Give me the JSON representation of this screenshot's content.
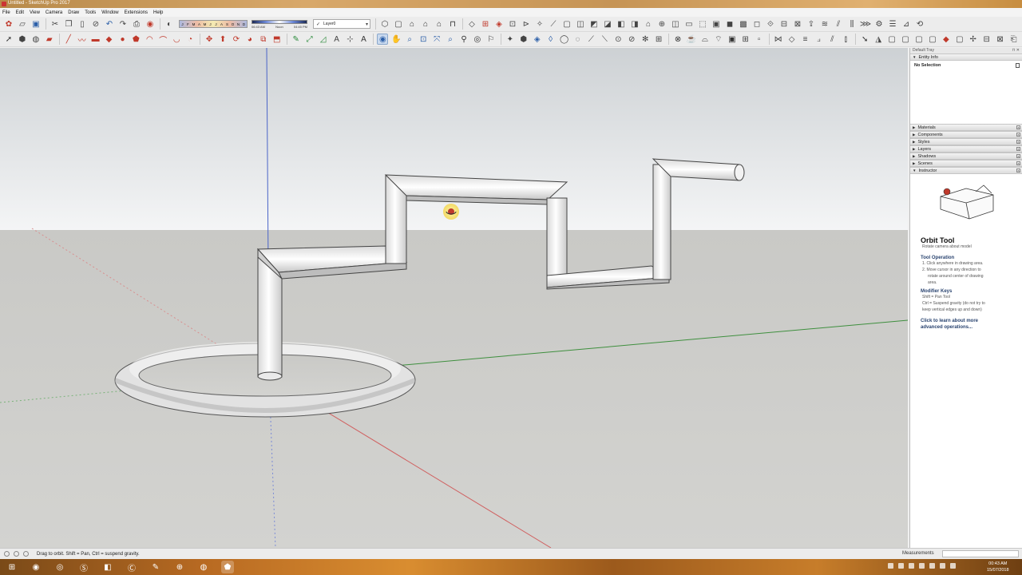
{
  "window": {
    "title": "Untitled - SketchUp Pro 2017"
  },
  "menu": [
    "File",
    "Edit",
    "View",
    "Camera",
    "Draw",
    "Tools",
    "Window",
    "Extensions",
    "Help"
  ],
  "shadow": {
    "months": [
      "J",
      "F",
      "M",
      "A",
      "M",
      "J",
      "J",
      "A",
      "S",
      "O",
      "N",
      "D"
    ],
    "time_start": "06:43 AM",
    "time_mid": "Noon",
    "time_end": "04:45 PM"
  },
  "layer": {
    "current": "Layer0"
  },
  "tray": {
    "title": "Default Tray",
    "entity_info": {
      "label": "Entity Info",
      "selection": "No Selection"
    },
    "panels": [
      "Materials",
      "Components",
      "Styles",
      "Layers",
      "Shadows",
      "Scenes"
    ],
    "instructor": {
      "label": "Instructor",
      "tool_title": "Orbit Tool",
      "tool_subtitle": "Rotate camera about model",
      "operation_title": "Tool Operation",
      "operation_lines": [
        "1. Click anywhere in drawing area.",
        "2. Move cursor in any direction to",
        "rotate around center of drawing",
        "area."
      ],
      "modifier_title": "Modifier Keys",
      "modifier_lines": [
        "Shift = Pan Tool",
        "Ctrl = Suspend gravity (do not try to",
        "keep vertical edges up and down)"
      ],
      "learn_line1": "Click to learn about more",
      "learn_line2": "advanced operations..."
    }
  },
  "status": {
    "message": "Drag to orbit. Shift = Pan, Ctrl = suspend gravity.",
    "measurements_label": "Measurements"
  },
  "clock": {
    "time": "00:43 AM",
    "date": "15/07/2018"
  },
  "colors": {
    "axis_red": "#d06060",
    "axis_green": "#3e8f3e",
    "axis_blue": "#4a64c8",
    "sky_top": "#cdd1d4",
    "ground": "#cfcfcc"
  },
  "icons": {
    "toolbar_top": [
      "getting-started",
      "open",
      "save",
      "cut",
      "copy",
      "paste",
      "erase",
      "undo",
      "redo",
      "print",
      "model-info",
      "shadow-toggle"
    ],
    "toolbar_bottom": [
      "select",
      "make-component",
      "paint-bucket",
      "eraser",
      "line",
      "freehand",
      "rectangle",
      "rotated-rectangle",
      "circle",
      "polygon",
      "arc",
      "two-point-arc",
      "three-point-arc",
      "pie",
      "move",
      "push-pull",
      "rotate",
      "follow-me",
      "scale",
      "offset",
      "tape-measure",
      "dimension",
      "protractor",
      "text",
      "axes",
      "3d-text",
      "orbit",
      "pan",
      "zoom",
      "zoom-window",
      "zoom-extents",
      "previous",
      "next",
      "walk",
      "look-around",
      "position-camera",
      "section-plane"
    ]
  }
}
